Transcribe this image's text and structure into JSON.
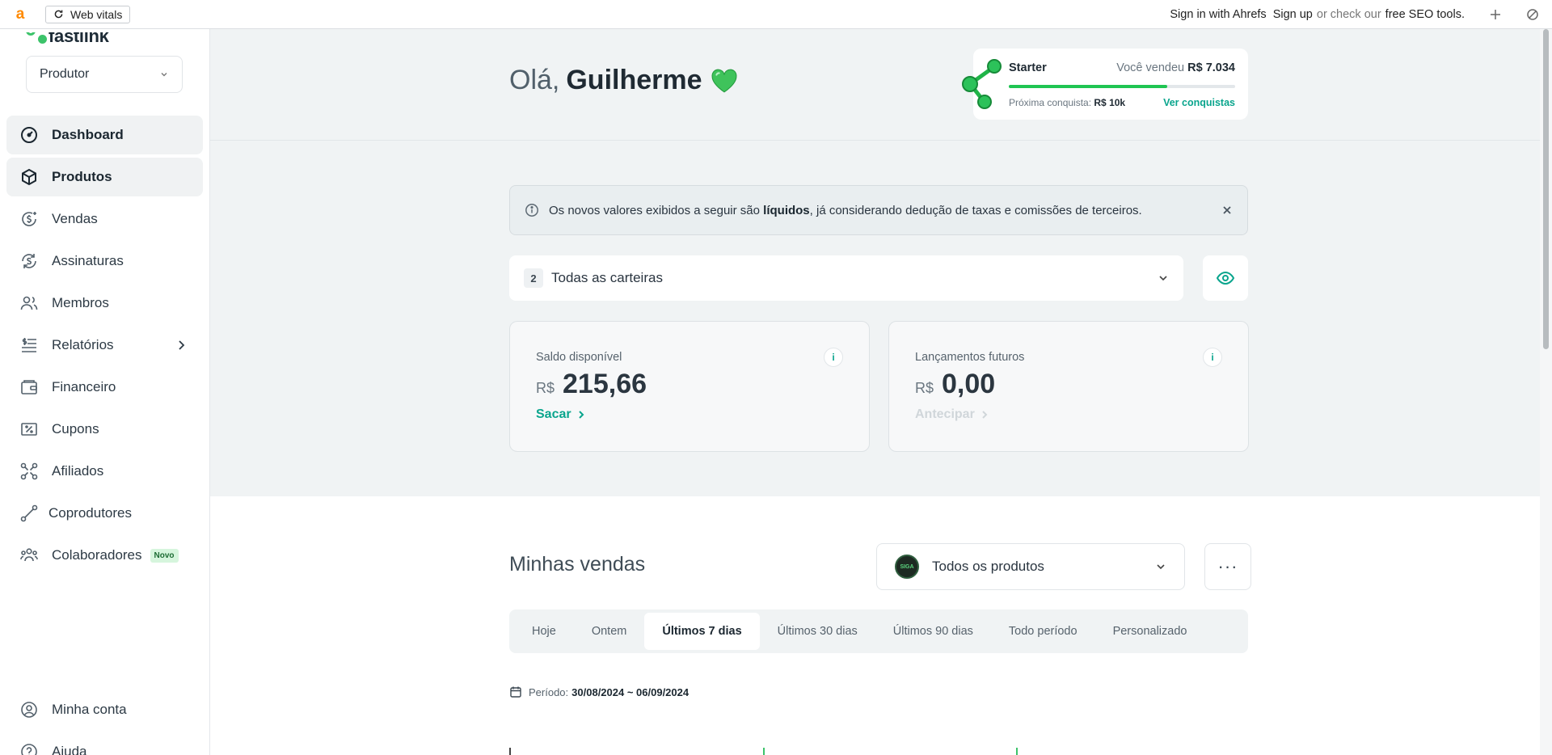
{
  "toolbar": {
    "logo": "a",
    "web_vitals": "Web vitals",
    "sign_in": "Sign in with Ahrefs",
    "sign_up": "Sign up",
    "or_check": "or check our",
    "seo_tools": "free SEO tools."
  },
  "sidebar": {
    "brand": "fastlink",
    "role": "Produtor",
    "items": [
      {
        "label": "Dashboard",
        "icon": "dashboard-icon"
      },
      {
        "label": "Produtos",
        "icon": "box-icon"
      },
      {
        "label": "Vendas",
        "icon": "dollar-cycle-icon"
      },
      {
        "label": "Assinaturas",
        "icon": "subscription-icon"
      },
      {
        "label": "Membros",
        "icon": "users-icon"
      },
      {
        "label": "Relatórios",
        "icon": "report-icon"
      },
      {
        "label": "Financeiro",
        "icon": "wallet-icon"
      },
      {
        "label": "Cupons",
        "icon": "coupon-icon"
      },
      {
        "label": "Afiliados",
        "icon": "affiliate-icon"
      },
      {
        "label": "Coprodutores",
        "icon": "coproducer-icon"
      },
      {
        "label": "Colaboradores",
        "icon": "team-icon",
        "badge": "Novo"
      }
    ],
    "bottom": [
      {
        "label": "Minha conta",
        "icon": "user-circle-icon"
      },
      {
        "label": "Ajuda",
        "icon": "help-icon"
      }
    ]
  },
  "header": {
    "greeting": "Olá,",
    "name": "Guilherme",
    "level": {
      "title": "Starter",
      "sold_label": "Você vendeu",
      "sold_value": "R$ 7.034",
      "progress": 0.7,
      "next_label": "Próxima conquista:",
      "next_value": "R$ 10k",
      "link": "Ver conquistas"
    }
  },
  "notice": {
    "text_before": "Os novos valores exibidos a seguir são",
    "bold": "líquidos",
    "text_after": ", já considerando dedução de taxas e comissões de terceiros."
  },
  "wallet": {
    "count": "2",
    "label": "Todas as carteiras"
  },
  "balances": [
    {
      "label": "Saldo disponível",
      "currency": "R$",
      "value": "215,66",
      "action": "Sacar",
      "enabled": true,
      "info": "i"
    },
    {
      "label": "Lançamentos futuros",
      "currency": "R$",
      "value": "0,00",
      "action": "Antecipar",
      "enabled": false,
      "info": "i"
    }
  ],
  "sales": {
    "title": "Minhas vendas",
    "product_filter": "Todos os produtos",
    "product_thumb": "SIGA",
    "more": "···",
    "tabs": [
      "Hoje",
      "Ontem",
      "Últimos 7 dias",
      "Últimos 30 dias",
      "Últimos 90 dias",
      "Todo período",
      "Personalizado"
    ],
    "active_tab": "Últimos 7 dias",
    "period_label": "Período:",
    "period_value": "30/08/2024 ~ 06/09/2024"
  },
  "colors": {
    "accent": "#0aa58d",
    "progress": "#1fc552",
    "panel_bg": "#f0f3f4"
  }
}
